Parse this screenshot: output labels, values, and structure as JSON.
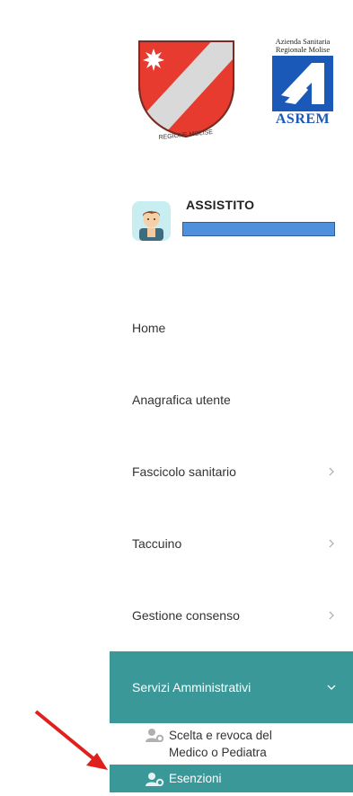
{
  "logos": {
    "region_logo_text": "REGIONE MOLISE",
    "asrem_header": "Azienda Sanitaria Regionale Molise",
    "asrem_name": "ASREM"
  },
  "user": {
    "role": "ASSISTITO"
  },
  "nav": {
    "items": [
      {
        "label": "Home"
      },
      {
        "label": "Anagrafica utente"
      },
      {
        "label": "Fascicolo sanitario"
      },
      {
        "label": "Taccuino"
      },
      {
        "label": "Gestione consenso"
      },
      {
        "label": "Servizi Amministrativi"
      }
    ],
    "submenu": [
      {
        "label_line1": "Scelta e revoca del",
        "label_line2": "Medico o Pediatra"
      },
      {
        "label": "Esenzioni"
      }
    ]
  },
  "colors": {
    "accent": "#3b9898",
    "arrow": "#e0201c",
    "name_mask": "#4f90dd"
  }
}
